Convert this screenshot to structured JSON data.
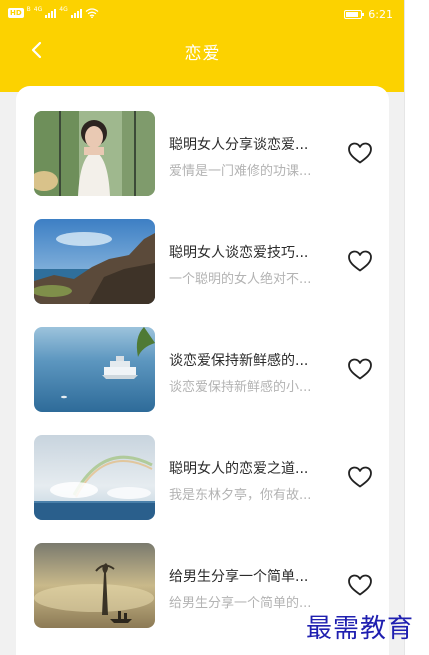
{
  "status_bar": {
    "hd_badge": "HD",
    "hd_subscript": "B",
    "network_1": "4G",
    "network_2": "4G",
    "battery_level": 0.85,
    "time": "6:21"
  },
  "header": {
    "back_icon": "chevron-left-icon",
    "title": "恋爱"
  },
  "articles": [
    {
      "title": "聪明女人分享谈恋爱...",
      "subtitle": "爱情是一门难修的功课...",
      "image": "woman-portrait-photo"
    },
    {
      "title": "聪明女人谈恋爱技巧...",
      "subtitle": "一个聪明的女人绝对不...",
      "image": "coastal-rocks-photo"
    },
    {
      "title": "谈恋爱保持新鲜感的...",
      "subtitle": "谈恋爱保持新鲜感的小...",
      "image": "cruise-ship-photo"
    },
    {
      "title": "聪明女人的恋爱之道...",
      "subtitle": "我是东林夕亭，你有故...",
      "image": "rainbow-sea-photo"
    },
    {
      "title": "给男生分享一个简单...",
      "subtitle": "给男生分享一个简单的...",
      "image": "misty-lake-photo"
    }
  ],
  "favorite_icon": "heart-outline-icon",
  "watermark": "最需教育"
}
